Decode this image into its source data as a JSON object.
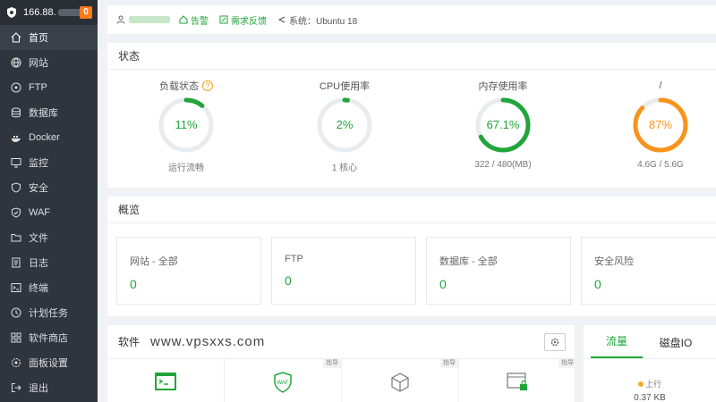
{
  "sidebar": {
    "ip": "166.88.",
    "badge": "0",
    "items": [
      {
        "label": "首页",
        "icon": "home-icon",
        "active": true
      },
      {
        "label": "网站",
        "icon": "globe-icon"
      },
      {
        "label": "FTP",
        "icon": "ftp-icon"
      },
      {
        "label": "数据库",
        "icon": "database-icon"
      },
      {
        "label": "Docker",
        "icon": "docker-icon"
      },
      {
        "label": "监控",
        "icon": "monitor-icon"
      },
      {
        "label": "安全",
        "icon": "shield-icon"
      },
      {
        "label": "WAF",
        "icon": "waf-icon"
      },
      {
        "label": "文件",
        "icon": "folder-icon"
      },
      {
        "label": "日志",
        "icon": "log-icon"
      },
      {
        "label": "终端",
        "icon": "terminal-icon"
      },
      {
        "label": "计划任务",
        "icon": "clock-icon"
      },
      {
        "label": "软件商店",
        "icon": "store-icon"
      },
      {
        "label": "面板设置",
        "icon": "settings-icon"
      },
      {
        "label": "退出",
        "icon": "logout-icon"
      }
    ]
  },
  "topbar": {
    "alert_label": "告警",
    "feedback_label": "需求反馈",
    "system_label": "系统：Ubuntu 18"
  },
  "status": {
    "title": "状态",
    "gauges": [
      {
        "title": "负载状态",
        "value": "11%",
        "sub": "运行流畅",
        "percent": 11,
        "color": "#20a53a",
        "help": "?"
      },
      {
        "title": "CPU使用率",
        "value": "2%",
        "sub": "1 核心",
        "percent": 2,
        "color": "#20a53a"
      },
      {
        "title": "内存使用率",
        "value": "67.1%",
        "sub": "322 / 480(MB)",
        "percent": 67.1,
        "color": "#20a53a"
      },
      {
        "title": "/",
        "value": "87%",
        "sub": "4.6G / 5.6G",
        "percent": 87,
        "color": "#f7941d"
      }
    ]
  },
  "overview": {
    "title": "概览",
    "cards": [
      {
        "label": "网站 - 全部",
        "value": "0"
      },
      {
        "label": "FTP",
        "value": "0"
      },
      {
        "label": "数据库 - 全部",
        "value": "0"
      },
      {
        "label": "安全风险",
        "value": "0"
      }
    ]
  },
  "software": {
    "title": "软件",
    "watermark": "www.vpsxxs.com",
    "pin_label": "指导",
    "tiles": [
      "terminal-app-icon",
      "waf-app-icon",
      "package-app-icon",
      "browser-lock-app-icon"
    ]
  },
  "traffic": {
    "tabs": [
      "流量",
      "磁盘IO"
    ],
    "up_label": "上行",
    "up_value": "0.37 KB"
  },
  "colors": {
    "accent": "#20a53a",
    "warning": "#f7941d",
    "sidebar_bg": "#30353d"
  }
}
